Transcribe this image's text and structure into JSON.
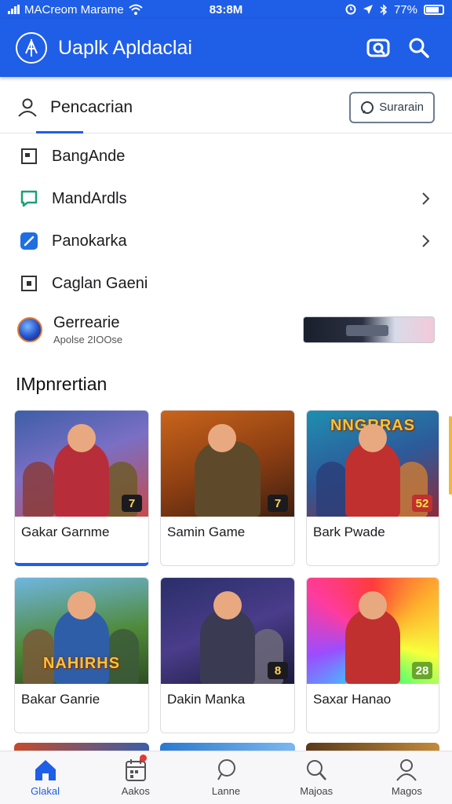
{
  "status_bar": {
    "carrier": "MACreom Marame",
    "time": "83:8M",
    "battery": "77%"
  },
  "app_bar": {
    "title": "Uaplk Apldaclai",
    "icons": [
      "logo-icon",
      "camera-search-icon",
      "search-icon"
    ]
  },
  "search_row": {
    "label": "Pencacrian",
    "button_label": "Surarain"
  },
  "menu": {
    "items": [
      {
        "label": "BangAnde",
        "icon": "document-icon",
        "chevron": false
      },
      {
        "label": "MandArdls",
        "icon": "chat-icon",
        "chevron": true
      },
      {
        "label": "Panokarka",
        "icon": "edit-icon",
        "chevron": true
      },
      {
        "label": "Caglan Gaeni",
        "icon": "square-icon",
        "chevron": false
      }
    ]
  },
  "promo": {
    "title": "Gerrearie",
    "subtitle": "Apolse 2IOOse"
  },
  "section": {
    "title": "IMpnrertian"
  },
  "games": [
    {
      "label": "Gakar Garnme",
      "badge": "7",
      "theme": "blue-red"
    },
    {
      "label": "Samin Game",
      "badge": "7",
      "theme": "orange"
    },
    {
      "label": "Bark Pwade",
      "badge": "52",
      "theme": "teal-red",
      "art_text": "NNGRRAS"
    },
    {
      "label": "Bakar Ganrie",
      "badge": "",
      "theme": "green",
      "art_text": "NAHIRHS"
    },
    {
      "label": "Dakin Manka",
      "badge": "8",
      "theme": "purple"
    },
    {
      "label": "Saxar Hanao",
      "badge": "28",
      "theme": "rainbow"
    }
  ],
  "bottom_nav": [
    {
      "label": "Glakal",
      "icon": "home-icon",
      "active": true
    },
    {
      "label": "Aakos",
      "icon": "calendar-icon",
      "active": false,
      "notification": true
    },
    {
      "label": "Lanne",
      "icon": "chat-bubble-icon",
      "active": false
    },
    {
      "label": "Majoas",
      "icon": "search-icon",
      "active": false
    },
    {
      "label": "Magos",
      "icon": "profile-icon",
      "active": false
    }
  ],
  "colors": {
    "primary": "#1f5ee6",
    "text": "#1b1b1f",
    "notification": "#e53935"
  }
}
